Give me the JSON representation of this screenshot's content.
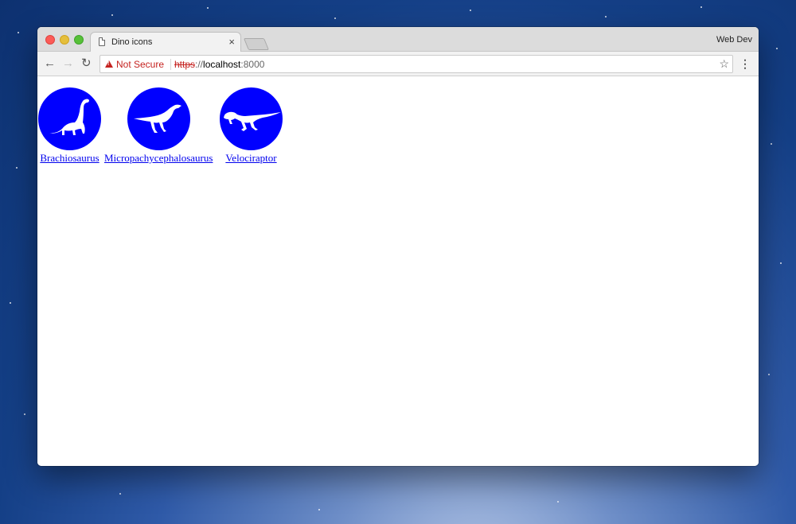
{
  "browser": {
    "tab": {
      "title": "Dino icons",
      "close_glyph": "×"
    },
    "profile_label": "Web Dev",
    "nav": {
      "back_glyph": "←",
      "forward_glyph": "→",
      "reload_glyph": "↻"
    },
    "address": {
      "security_label": "Not Secure",
      "scheme": "https",
      "separator": "://",
      "host": "localhost",
      "port": ":8000"
    },
    "bookmark_glyph": "☆",
    "menu_glyph": "⋮"
  },
  "page": {
    "dinos": [
      {
        "label": "Brachiosaurus",
        "icon": "brachiosaurus-icon"
      },
      {
        "label": "Micropachycephalosaurus",
        "icon": "micropachycephalosaurus-icon"
      },
      {
        "label": "Velociraptor",
        "icon": "velociraptor-icon"
      }
    ]
  },
  "colors": {
    "icon_circle": "#0000ff",
    "link": "#0000ee",
    "not_secure": "#c5221f"
  }
}
